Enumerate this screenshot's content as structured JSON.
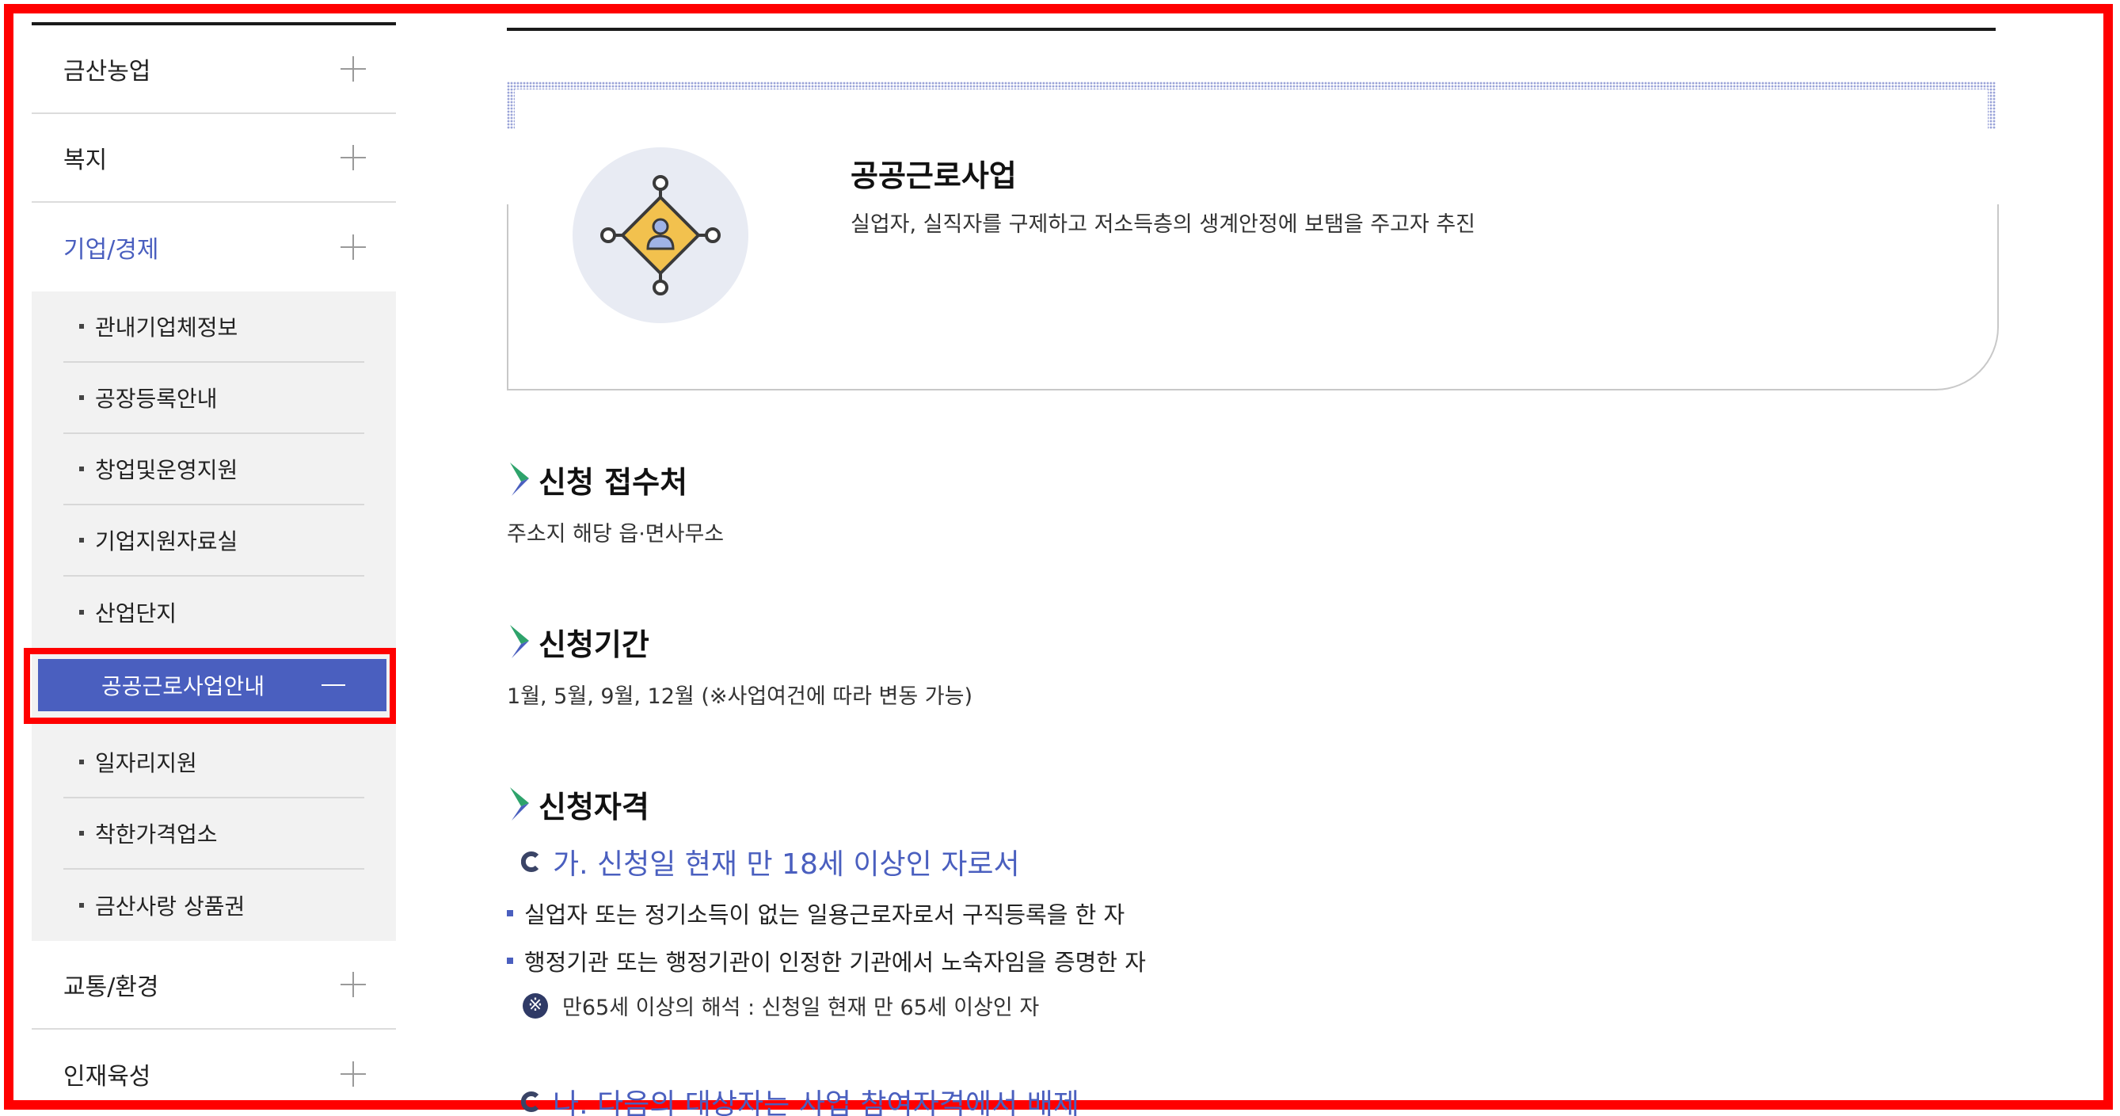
{
  "sidebar": {
    "items": [
      {
        "label": "금산농업"
      },
      {
        "label": "복지"
      },
      {
        "label": "기업/경제"
      },
      {
        "label": "교통/환경"
      },
      {
        "label": "인재육성"
      }
    ],
    "submenu": [
      {
        "label": "관내기업체정보"
      },
      {
        "label": "공장등록안내"
      },
      {
        "label": "창업및운영지원"
      },
      {
        "label": "기업지원자료실"
      },
      {
        "label": "산업단지"
      },
      {
        "label": "공공근로사업안내"
      },
      {
        "label": "일자리지원"
      },
      {
        "label": "착한가격업소"
      },
      {
        "label": "금산사랑 상품권"
      }
    ]
  },
  "card": {
    "title": "공공근로사업",
    "description": "실업자, 실직자를 구제하고 저소득층의 생계안정에 보탬을 주고자 추진"
  },
  "sections": {
    "office": {
      "heading": "신청 접수처",
      "text": "주소지 해당 읍·면사무소"
    },
    "period": {
      "heading": "신청기간",
      "text": "1월, 5월, 9월, 12월 (※사업여건에 따라 변동 가능)"
    },
    "eligibility": {
      "heading": "신청자격",
      "sub_a": "가. 신청일 현재 만 18세 이상인 자로서",
      "bullets": [
        "실업자 또는 정기소득이 없는 일용근로자로서 구직등록을 한 자",
        "행정기관 또는 행정기관이 인정한 기관에서 노숙자임을 증명한 자"
      ],
      "note_mark": "※",
      "note": "만65세 이상의 해석 : 신청일 현재 만 65세 이상인 자",
      "sub_b": "나. 다음의 대상자는 사업 참여자격에서 배제"
    }
  },
  "colors": {
    "accent": "#4a5fbf",
    "highlight_frame": "#ff0000",
    "icon_yellow": "#f2c14e",
    "icon_bg": "#e8ebf3"
  }
}
